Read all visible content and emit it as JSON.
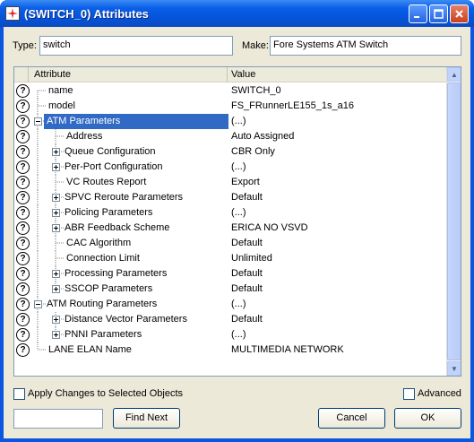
{
  "window": {
    "title": "(SWITCH_0) Attributes"
  },
  "type_label": "Type:",
  "type_value": "switch",
  "make_label": "Make:",
  "make_value": "Fore Systems ATM Switch",
  "columns": {
    "attribute": "Attribute",
    "value": "Value"
  },
  "rows": [
    {
      "name": "name",
      "value": "SWITCH_0"
    },
    {
      "name": "model",
      "value": "FS_FRunnerLE155_1s_a16"
    },
    {
      "name": "ATM Parameters",
      "value": "(...)"
    },
    {
      "name": "Address",
      "value": "Auto Assigned"
    },
    {
      "name": "Queue Configuration",
      "value": "CBR Only"
    },
    {
      "name": "Per-Port Configuration",
      "value": "(...)"
    },
    {
      "name": "VC Routes Report",
      "value": "Export"
    },
    {
      "name": "SPVC Reroute Parameters",
      "value": "Default"
    },
    {
      "name": "Policing Parameters",
      "value": "(...)"
    },
    {
      "name": "ABR Feedback Scheme",
      "value": "ERICA NO VSVD"
    },
    {
      "name": "CAC Algorithm",
      "value": "Default"
    },
    {
      "name": "Connection Limit",
      "value": "Unlimited"
    },
    {
      "name": "Processing Parameters",
      "value": "Default"
    },
    {
      "name": "SSCOP Parameters",
      "value": "Default"
    },
    {
      "name": "ATM Routing Parameters",
      "value": "(...)"
    },
    {
      "name": "Distance Vector Parameters",
      "value": "Default"
    },
    {
      "name": "PNNI Parameters",
      "value": "(...)"
    },
    {
      "name": "LANE ELAN Name",
      "value": "MULTIMEDIA NETWORK"
    }
  ],
  "help_glyph": "?",
  "apply_label": "Apply Changes to Selected Objects",
  "advanced_label": "Advanced",
  "find_value": "",
  "find_next_label": "Find Next",
  "cancel_label": "Cancel",
  "ok_label": "OK",
  "icons": [
    "app-icon",
    "minimize-icon",
    "maximize-icon",
    "close-icon",
    "help-icon",
    "expand-icon",
    "collapse-icon",
    "scroll-up-icon",
    "scroll-down-icon"
  ]
}
